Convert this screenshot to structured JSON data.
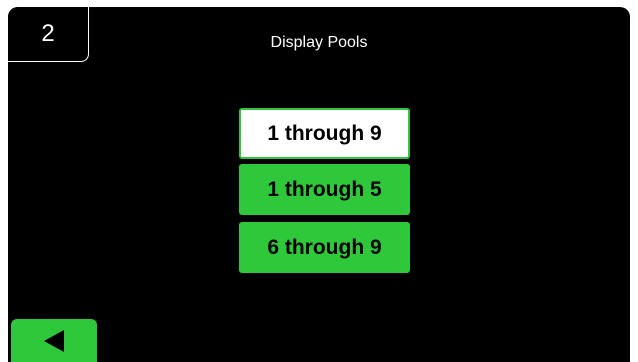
{
  "header": {
    "page_number": "2",
    "title": "Display Pools"
  },
  "options": [
    {
      "label": "1 through 9",
      "selected": true
    },
    {
      "label": "1 through 5",
      "selected": false
    },
    {
      "label": "6 through 9",
      "selected": false
    }
  ],
  "footer": {
    "back_icon": "left-triangle-icon"
  },
  "colors": {
    "background": "#000000",
    "accent_green": "#2fc83a",
    "selected_bg": "#ffffff",
    "text_light": "#ffffff"
  }
}
